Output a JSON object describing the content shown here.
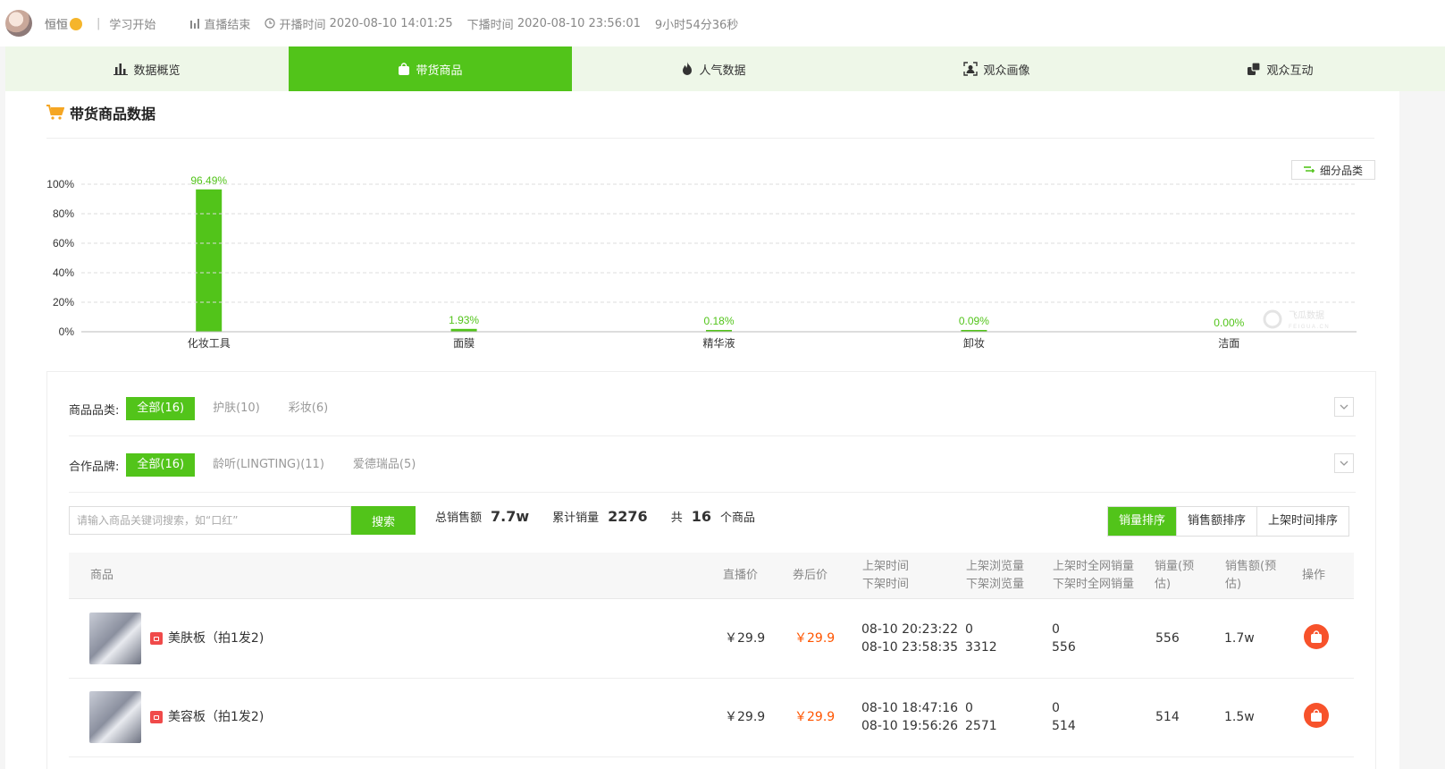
{
  "header": {
    "anchor_name": "恒恒",
    "separator": "|",
    "live_title": "学习开始",
    "status": "直播结束",
    "start_label": "开播时间",
    "start_time": "2020-08-10 14:01:25",
    "end_label": "下播时间",
    "end_time": "2020-08-10 23:56:01",
    "duration": "9小时54分36秒"
  },
  "tabs": [
    {
      "label": "数据概览",
      "icon": "bar-chart-icon"
    },
    {
      "label": "带货商品",
      "icon": "shopping-bag-icon",
      "active": true
    },
    {
      "label": "人气数据",
      "icon": "flame-icon"
    },
    {
      "label": "观众画像",
      "icon": "portrait-icon"
    },
    {
      "label": "观众互动",
      "icon": "interaction-icon"
    }
  ],
  "section": {
    "title": "带货商品数据",
    "subcategory_button": "细分品类"
  },
  "chart_data": {
    "type": "bar",
    "categories": [
      "化妆工具",
      "面膜",
      "精华液",
      "卸妆",
      "洁面"
    ],
    "values": [
      96.49,
      1.93,
      0.18,
      0.09,
      0.0
    ],
    "value_labels": [
      "96.49%",
      "1.93%",
      "0.18%",
      "0.09%",
      "0.00%"
    ],
    "yticks": [
      "0%",
      "20%",
      "40%",
      "60%",
      "80%",
      "100%"
    ],
    "ylim": [
      0,
      100
    ],
    "grid": true,
    "bar_color": "#52c41a"
  },
  "filters": {
    "category_label": "商品品类:",
    "category_options": [
      {
        "label": "全部(16)",
        "active": true
      },
      {
        "label": "护肤(10)"
      },
      {
        "label": "彩妆(6)"
      }
    ],
    "brand_label": "合作品牌:",
    "brand_options": [
      {
        "label": "全部(16)",
        "active": true
      },
      {
        "label": "龄听(LINGTING)(11)"
      },
      {
        "label": "爱德瑞品(5)"
      }
    ]
  },
  "search": {
    "placeholder": "请输入商品关键词搜索，如“口红”",
    "button": "搜索"
  },
  "stats": {
    "total_sales_label": "总销售额",
    "total_sales": "7.7w",
    "total_volume_label": "累计销量",
    "total_volume": "2276",
    "count_prefix": "共",
    "count": "16",
    "count_suffix": "个商品"
  },
  "sorts": [
    {
      "label": "销量排序",
      "active": true
    },
    {
      "label": "销售额排序"
    },
    {
      "label": "上架时间排序"
    }
  ],
  "table": {
    "headers": {
      "product": "商品",
      "live_price": "直播价",
      "coupon_price": "券后价",
      "time_on": "上架时间",
      "time_off": "下架时间",
      "views_on": "上架浏览量",
      "views_off": "下架浏览量",
      "net_on": "上架时全网销量",
      "net_off": "下架时全网销量",
      "volume_1": "销量(预",
      "volume_2": "估)",
      "sales_1": "销售额(预",
      "sales_2": "估)",
      "action": "操作"
    },
    "rows": [
      {
        "name": "美肤板（拍1发2)",
        "live_price": "￥29.9",
        "coupon_price": "￥29.9",
        "time_on": "08-10 20:23:22",
        "time_off": "08-10 23:58:35",
        "views_on": "0",
        "views_off": "3312",
        "net_on": "0",
        "net_off": "556",
        "volume": "556",
        "sales": "1.7w"
      },
      {
        "name": "美容板（拍1发2)",
        "live_price": "￥29.9",
        "coupon_price": "￥29.9",
        "time_on": "08-10 18:47:16",
        "time_off": "08-10 19:56:26",
        "views_on": "0",
        "views_off": "2571",
        "net_on": "0",
        "net_off": "514",
        "volume": "514",
        "sales": "1.5w"
      }
    ]
  }
}
